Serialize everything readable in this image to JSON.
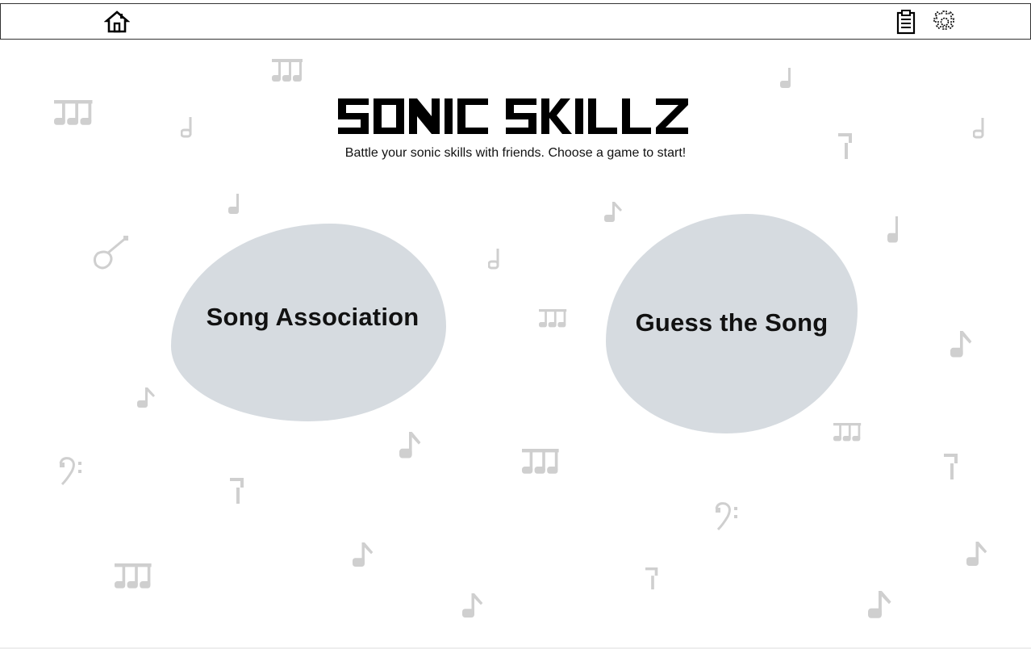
{
  "topbar": {
    "home_icon": "home-icon",
    "clipboard_icon": "clipboard-icon",
    "settings_icon": "gear-icon"
  },
  "header": {
    "title": "SONIC SKILLZ",
    "subtitle": "Battle your sonic skills with friends. Choose a game to start!"
  },
  "games": [
    {
      "label": "Song Association"
    },
    {
      "label": "Guess the Song"
    }
  ],
  "colors": {
    "blob": "#d6dbe0",
    "decoration": "#d0d0d0",
    "text": "#111111"
  },
  "decorations": [
    "beamed-notes-icon",
    "half-note-icon",
    "quarter-note-icon",
    "eighth-note-icon",
    "eighth-rest-icon",
    "bass-clef-icon",
    "guitar-icon"
  ]
}
